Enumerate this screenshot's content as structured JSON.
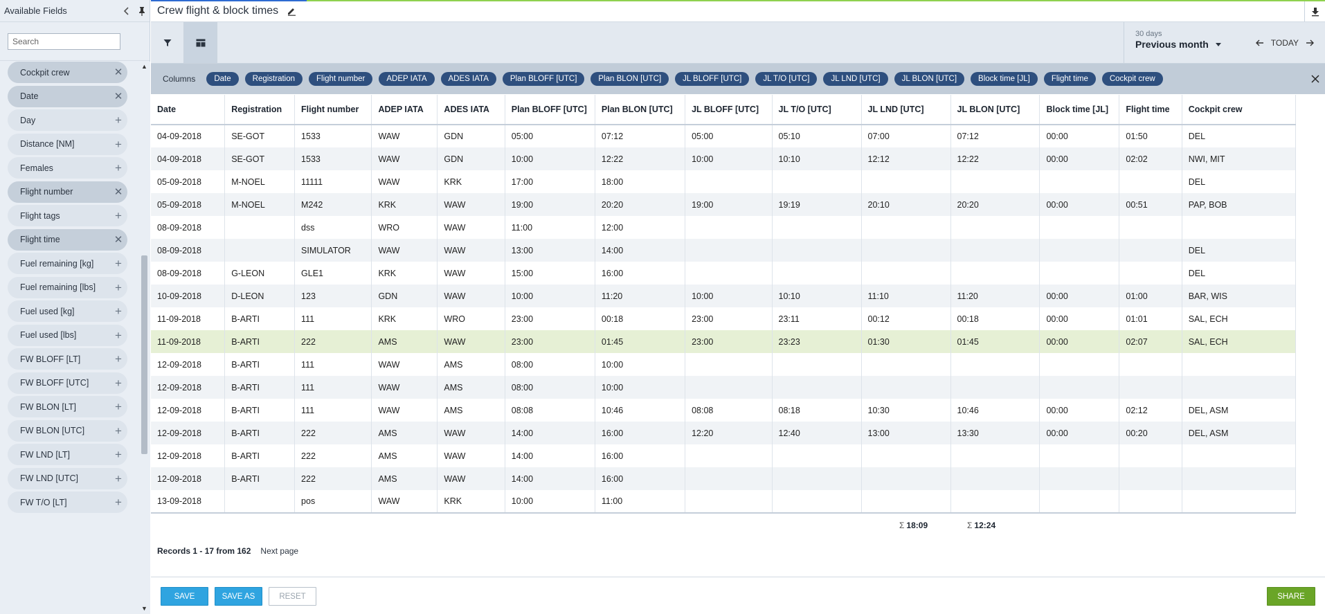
{
  "sidebar": {
    "title": "Available Fields",
    "search_placeholder": "Search",
    "fields": [
      {
        "label": "Cockpit crew",
        "selected": true
      },
      {
        "label": "Date",
        "selected": true
      },
      {
        "label": "Day",
        "selected": false
      },
      {
        "label": "Distance [NM]",
        "selected": false
      },
      {
        "label": "Females",
        "selected": false
      },
      {
        "label": "Flight number",
        "selected": true
      },
      {
        "label": "Flight tags",
        "selected": false
      },
      {
        "label": "Flight time",
        "selected": true
      },
      {
        "label": "Fuel remaining [kg]",
        "selected": false
      },
      {
        "label": "Fuel remaining [lbs]",
        "selected": false
      },
      {
        "label": "Fuel used [kg]",
        "selected": false
      },
      {
        "label": "Fuel used [lbs]",
        "selected": false
      },
      {
        "label": "FW BLOFF [LT]",
        "selected": false
      },
      {
        "label": "FW BLOFF [UTC]",
        "selected": false
      },
      {
        "label": "FW BLON [LT]",
        "selected": false
      },
      {
        "label": "FW BLON [UTC]",
        "selected": false
      },
      {
        "label": "FW LND [LT]",
        "selected": false
      },
      {
        "label": "FW LND [UTC]",
        "selected": false
      },
      {
        "label": "FW T/O [LT]",
        "selected": false
      }
    ]
  },
  "header": {
    "title": "Crew flight & block times"
  },
  "toolbar": {
    "period_small": "30 days",
    "period_label": "Previous month",
    "today_label": "TODAY"
  },
  "columns_bar": {
    "label": "Columns",
    "chips": [
      "Date",
      "Registration",
      "Flight number",
      "ADEP IATA",
      "ADES IATA",
      "Plan BLOFF [UTC]",
      "Plan BLON [UTC]",
      "JL BLOFF [UTC]",
      "JL T/O [UTC]",
      "JL LND [UTC]",
      "JL BLON [UTC]",
      "Block time [JL]",
      "Flight time",
      "Cockpit crew"
    ]
  },
  "table": {
    "headers": [
      "Date",
      "Registration",
      "Flight number",
      "ADEP IATA",
      "ADES IATA",
      "Plan BLOFF [UTC]",
      "Plan BLON [UTC]",
      "JL BLOFF [UTC]",
      "JL T/O [UTC]",
      "JL LND [UTC]",
      "JL BLON [UTC]",
      "Block time [JL]",
      "Flight time",
      "Cockpit crew"
    ],
    "rows": [
      [
        "04-09-2018",
        "SE-GOT",
        "1533",
        "WAW",
        "GDN",
        "05:00",
        "07:12",
        "05:00",
        "05:10",
        "07:00",
        "07:12",
        "00:00",
        "01:50",
        "DEL"
      ],
      [
        "04-09-2018",
        "SE-GOT",
        "1533",
        "WAW",
        "GDN",
        "10:00",
        "12:22",
        "10:00",
        "10:10",
        "12:12",
        "12:22",
        "00:00",
        "02:02",
        "NWI, MIT"
      ],
      [
        "05-09-2018",
        "M-NOEL",
        "11111",
        "WAW",
        "KRK",
        "17:00",
        "18:00",
        "",
        "",
        "",
        "",
        "",
        "",
        "DEL"
      ],
      [
        "05-09-2018",
        "M-NOEL",
        "M242",
        "KRK",
        "WAW",
        "19:00",
        "20:20",
        "19:00",
        "19:19",
        "20:10",
        "20:20",
        "00:00",
        "00:51",
        "PAP, BOB"
      ],
      [
        "08-09-2018",
        "",
        "dss",
        "WRO",
        "WAW",
        "11:00",
        "12:00",
        "",
        "",
        "",
        "",
        "",
        "",
        ""
      ],
      [
        "08-09-2018",
        "",
        "SIMULATOR",
        "WAW",
        "WAW",
        "13:00",
        "14:00",
        "",
        "",
        "",
        "",
        "",
        "",
        "DEL"
      ],
      [
        "08-09-2018",
        "G-LEON",
        "GLE1",
        "KRK",
        "WAW",
        "15:00",
        "16:00",
        "",
        "",
        "",
        "",
        "",
        "",
        "DEL"
      ],
      [
        "10-09-2018",
        "D-LEON",
        "123",
        "GDN",
        "WAW",
        "10:00",
        "11:20",
        "10:00",
        "10:10",
        "11:10",
        "11:20",
        "00:00",
        "01:00",
        "BAR, WIS"
      ],
      [
        "11-09-2018",
        "B-ARTI",
        "111",
        "KRK",
        "WRO",
        "23:00",
        "00:18",
        "23:00",
        "23:11",
        "00:12",
        "00:18",
        "00:00",
        "01:01",
        "SAL, ECH"
      ],
      [
        "11-09-2018",
        "B-ARTI",
        "222",
        "AMS",
        "WAW",
        "23:00",
        "01:45",
        "23:00",
        "23:23",
        "01:30",
        "01:45",
        "00:00",
        "02:07",
        "SAL, ECH"
      ],
      [
        "12-09-2018",
        "B-ARTI",
        "111",
        "WAW",
        "AMS",
        "08:00",
        "10:00",
        "",
        "",
        "",
        "",
        "",
        "",
        ""
      ],
      [
        "12-09-2018",
        "B-ARTI",
        "111",
        "WAW",
        "AMS",
        "08:00",
        "10:00",
        "",
        "",
        "",
        "",
        "",
        "",
        ""
      ],
      [
        "12-09-2018",
        "B-ARTI",
        "111",
        "WAW",
        "AMS",
        "08:08",
        "10:46",
        "08:08",
        "08:18",
        "10:30",
        "10:46",
        "00:00",
        "02:12",
        "DEL, ASM"
      ],
      [
        "12-09-2018",
        "B-ARTI",
        "222",
        "AMS",
        "WAW",
        "14:00",
        "16:00",
        "12:20",
        "12:40",
        "13:00",
        "13:30",
        "00:00",
        "00:20",
        "DEL, ASM"
      ],
      [
        "12-09-2018",
        "B-ARTI",
        "222",
        "AMS",
        "WAW",
        "14:00",
        "16:00",
        "",
        "",
        "",
        "",
        "",
        "",
        ""
      ],
      [
        "12-09-2018",
        "B-ARTI",
        "222",
        "AMS",
        "WAW",
        "14:00",
        "16:00",
        "",
        "",
        "",
        "",
        "",
        "",
        ""
      ],
      [
        "13-09-2018",
        "",
        "pos",
        "WAW",
        "KRK",
        "10:00",
        "11:00",
        "",
        "",
        "",
        "",
        "",
        "",
        ""
      ]
    ],
    "highlighted_row": 9,
    "totals": {
      "block_time": "18:09",
      "flight_time": "12:24"
    }
  },
  "pager": {
    "records": "Records 1 - 17 from 162",
    "next": "Next page"
  },
  "footer": {
    "save": "SAVE",
    "save_as": "SAVE AS",
    "reset": "RESET",
    "share": "SHARE"
  },
  "colors": {
    "chip": "#2e4f7e",
    "save": "#2fa4e0",
    "share": "#6aa527",
    "highlight_row": "#e6f0d5"
  }
}
